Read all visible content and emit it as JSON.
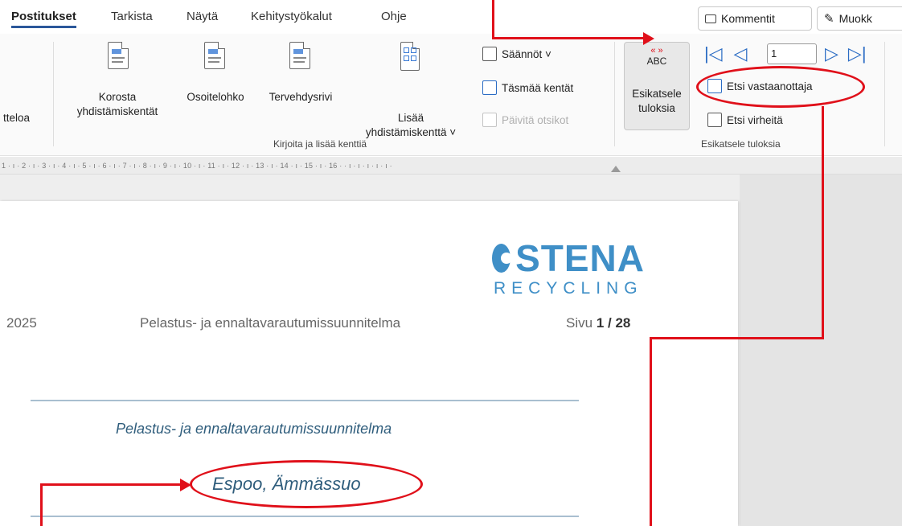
{
  "tabs": [
    "Postitukset",
    "Tarkista",
    "Näytä",
    "Kehitystyökalut",
    "Ohje"
  ],
  "top_buttons": {
    "comments": "Kommentit",
    "edit": "Muokk"
  },
  "ribbon": {
    "left_cut": "tteloa",
    "highlight_fields": {
      "line1": "Korosta",
      "line2": "yhdistämiskentät"
    },
    "address_block": "Osoitelohko",
    "greeting_line": "Tervehdysrivi",
    "insert_field": {
      "line1": "Lisää",
      "line2": "yhdistämiskenttä ˅"
    },
    "rules": "Säännöt ˅",
    "match_fields": "Täsmää kentät",
    "update_labels": "Päivitä otsikot",
    "group_write": "Kirjoita ja lisää kenttiä",
    "preview": {
      "abc": "ABC",
      "line1": "Esikatsele",
      "line2": "tuloksia"
    },
    "record_number": "1",
    "find_recipient": "Etsi vastaanottaja",
    "find_errors": "Etsi virheitä",
    "group_preview": "Esikatsele tuloksia"
  },
  "ruler_text": "1 · ı · 2 · ı · 3 · ı · 4 · ı · 5 · ı · 6 · ı · 7 · ı · 8 · ı · 9 · ı · 10 · ı · 11 · ı · 12 · ı · 13 · ı · 14 · ı · 15 · ı · 16 ·      · ı · ı · ı · ı · ı ·",
  "document": {
    "logo_main": "STENA",
    "logo_sub": "RECYCLING",
    "header_year": "2025",
    "header_title": "Pelastus- ja ennaltavarautumissuunnitelma",
    "page_prefix": "Sivu",
    "page_current": "1",
    "page_total": "/ 28",
    "subtitle": "Pelastus- ja ennaltavarautumissuunnitelma",
    "location": "Espoo, Ämmässuo"
  },
  "colors": {
    "annotation": "#e0101a",
    "accent": "#2b579a",
    "logo": "#3f8fc7"
  }
}
